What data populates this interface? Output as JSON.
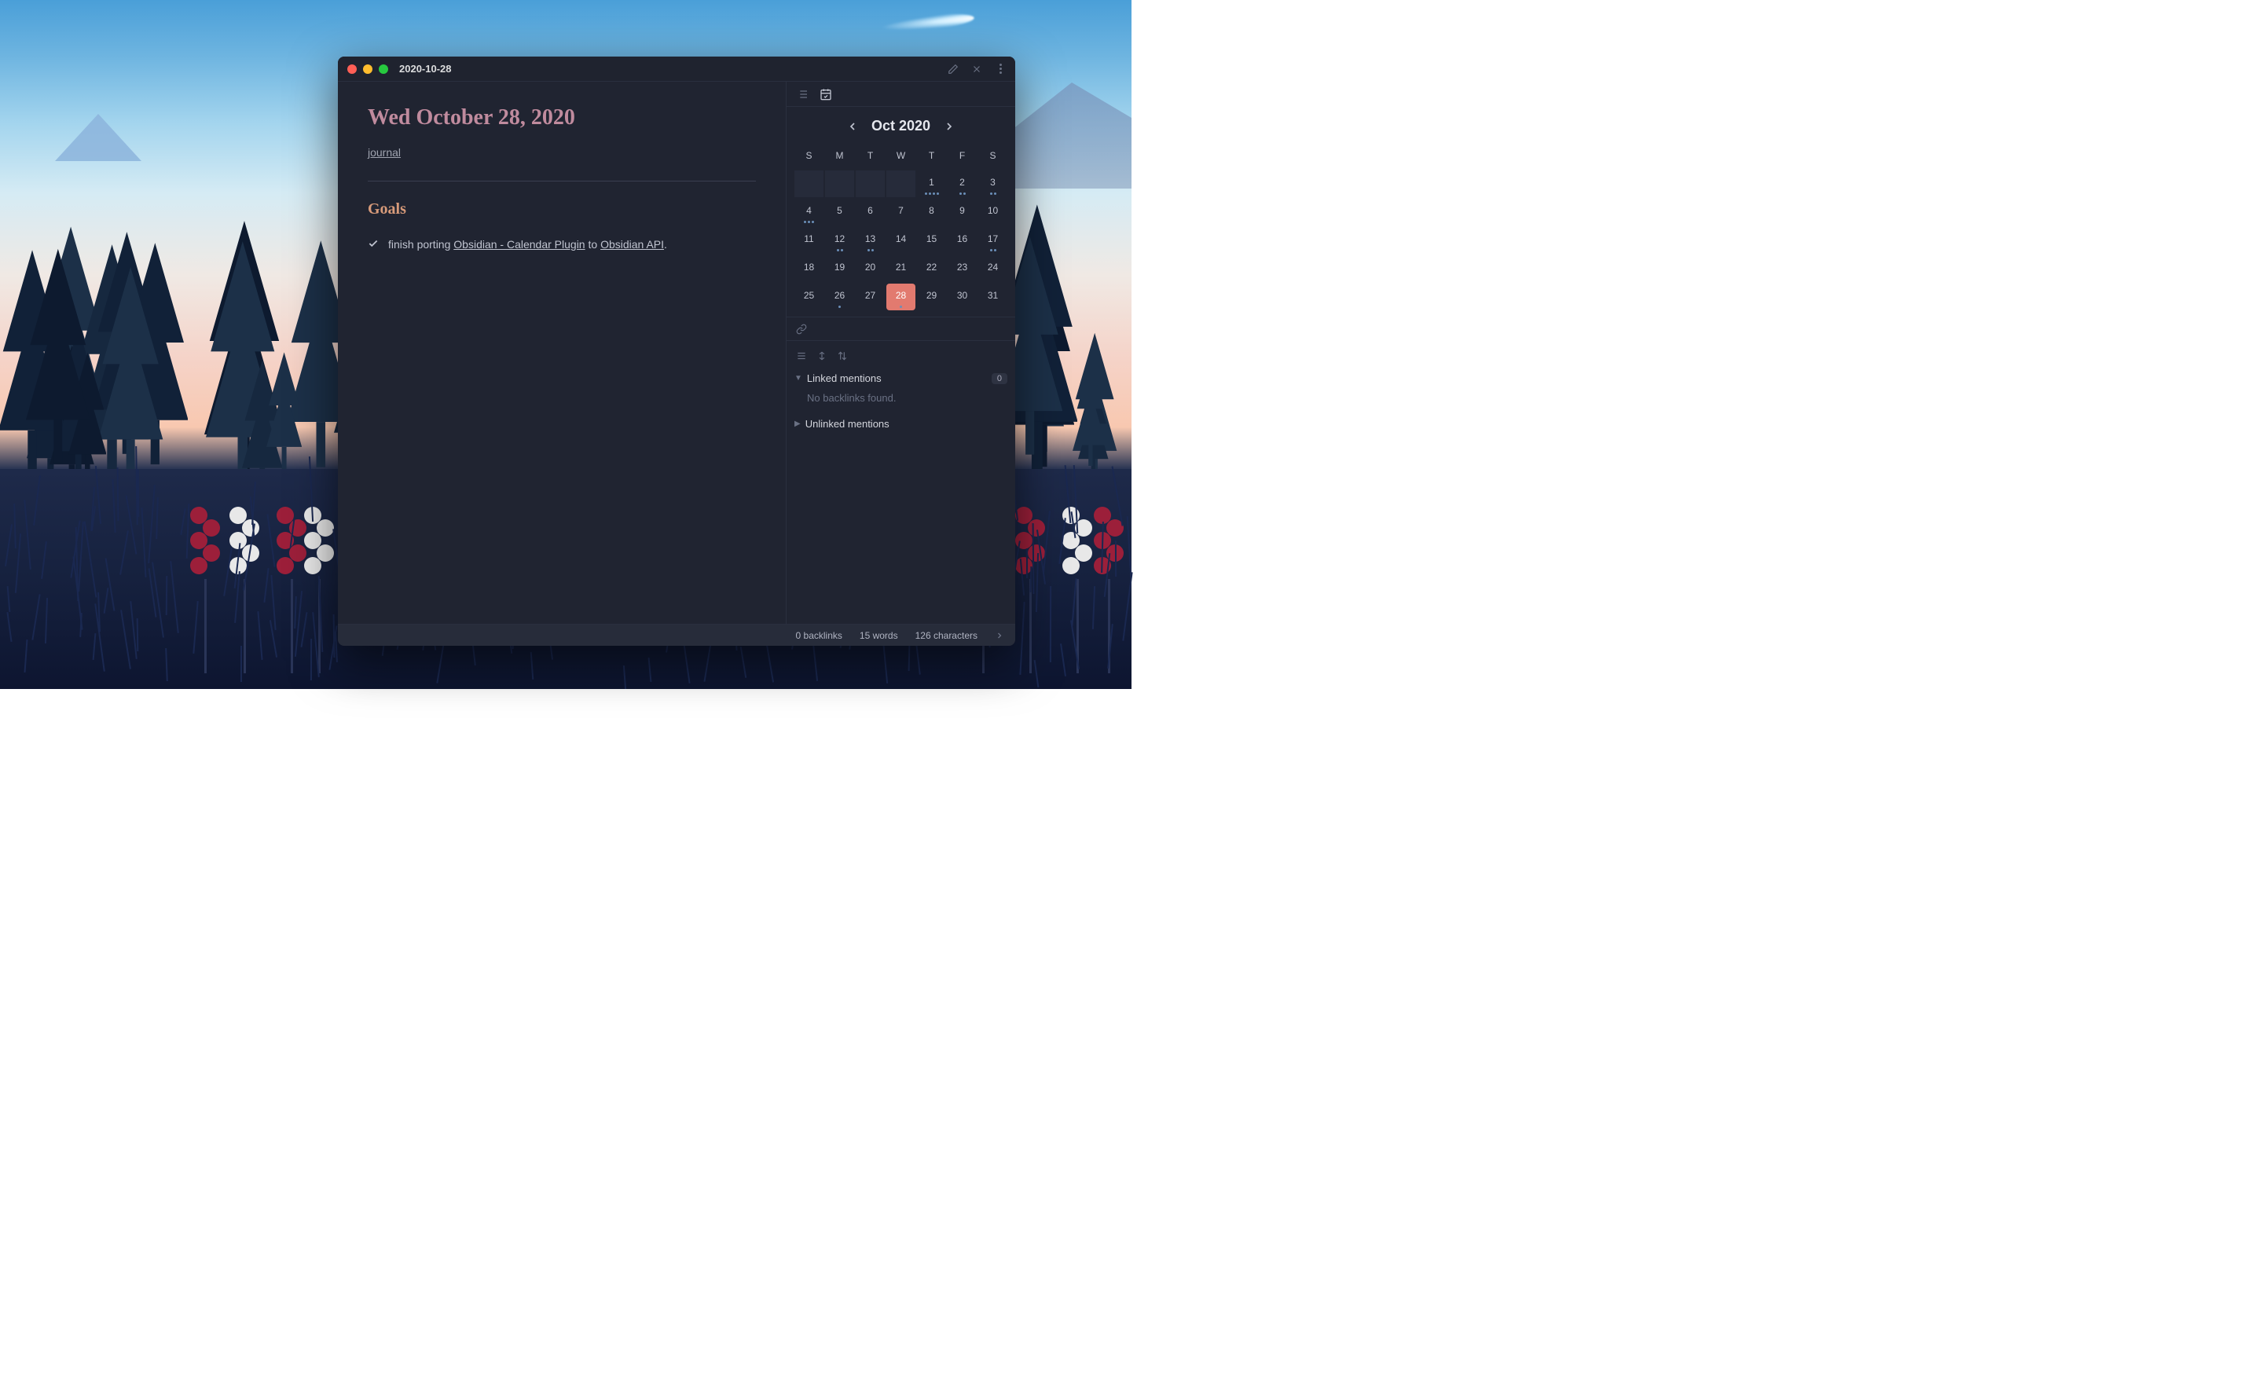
{
  "window": {
    "title": "2020-10-28"
  },
  "note": {
    "heading": "Wed October 28, 2020",
    "tag": "journal",
    "goals_heading": "Goals",
    "task_prefix": "finish porting ",
    "task_link1": "Obsidian - Calendar Plugin",
    "task_mid": " to ",
    "task_link2": "Obsidian API",
    "task_suffix": "."
  },
  "calendar": {
    "title": "Oct 2020",
    "dow": [
      "S",
      "M",
      "T",
      "W",
      "T",
      "F",
      "S"
    ],
    "empty_start": 4,
    "today": 28,
    "days": [
      {
        "n": 1,
        "dots": 4
      },
      {
        "n": 2,
        "dots": 2
      },
      {
        "n": 3,
        "dots": 2
      },
      {
        "n": 4,
        "dots": 3
      },
      {
        "n": 5,
        "dots": 0
      },
      {
        "n": 6,
        "dots": 0
      },
      {
        "n": 7,
        "dots": 0
      },
      {
        "n": 8,
        "dots": 0
      },
      {
        "n": 9,
        "dots": 0
      },
      {
        "n": 10,
        "dots": 0
      },
      {
        "n": 11,
        "dots": 0
      },
      {
        "n": 12,
        "dots": 2
      },
      {
        "n": 13,
        "dots": 2
      },
      {
        "n": 14,
        "dots": 0
      },
      {
        "n": 15,
        "dots": 0
      },
      {
        "n": 16,
        "dots": 0
      },
      {
        "n": 17,
        "dots": 2
      },
      {
        "n": 18,
        "dots": 0
      },
      {
        "n": 19,
        "dots": 0
      },
      {
        "n": 20,
        "dots": 0
      },
      {
        "n": 21,
        "dots": 0
      },
      {
        "n": 22,
        "dots": 0
      },
      {
        "n": 23,
        "dots": 0
      },
      {
        "n": 24,
        "dots": 0
      },
      {
        "n": 25,
        "dots": 0
      },
      {
        "n": 26,
        "dots": 1
      },
      {
        "n": 27,
        "dots": 0
      },
      {
        "n": 28,
        "dots": 1
      },
      {
        "n": 29,
        "dots": 0
      },
      {
        "n": 30,
        "dots": 0
      },
      {
        "n": 31,
        "dots": 0
      }
    ]
  },
  "backlinks": {
    "linked_label": "Linked mentions",
    "linked_count": "0",
    "empty_text": "No backlinks found.",
    "unlinked_label": "Unlinked mentions"
  },
  "status": {
    "backlinks": "0 backlinks",
    "words": "15 words",
    "chars": "126 characters"
  }
}
